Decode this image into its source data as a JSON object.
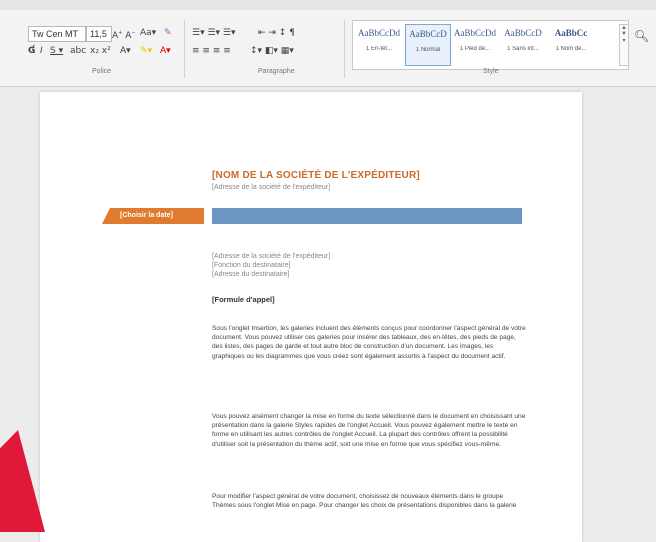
{
  "ribbon": {
    "font_name": "Tw Cen MT (",
    "font_size": "11,5",
    "group_font": "Police",
    "group_paragraph": "Paragraphe",
    "group_style": "Style",
    "styles": [
      {
        "sample": "AaBbCcDd",
        "name": "1 En-têt..."
      },
      {
        "sample": "AaBbCcD",
        "name": "1 Normal"
      },
      {
        "sample": "AaBbCcDd",
        "name": "1 Pied de..."
      },
      {
        "sample": "AaBbCcD",
        "name": "1 Sans int..."
      },
      {
        "sample": "AaBbCc",
        "name": "1 Nom de..."
      }
    ],
    "accent_color": "#2b579a"
  },
  "document": {
    "sender_name": "[NOM DE LA SOCIÉTÉ DE L'EXPÉDITEUR]",
    "sender_address": "[Adresse de la société de l'expéditeur]",
    "date_placeholder": "[Choisir la date]",
    "recipient_lines": [
      "[Adresse de la société de l'expéditeur]",
      "[Fonction du destinataire]",
      "[Adresse du destinataire]"
    ],
    "salutation": "[Formule d'appel]",
    "paragraphs": [
      "Sous l'onglet Insertion, les galeries incluent des éléments conçus pour coordonner l'aspect général de votre document. Vous pouvez utiliser ces galeries pour insérer des tableaux, des en-têtes, des pieds de page, des listes, des pages de garde et tout autre bloc de construction d'un document. Les images, les graphiques ou les diagrammes que vous créez sont également assortis à l'aspect du document actif.",
      "Vous pouvez aisément changer la mise en forme du texte sélectionné dans le document en choisissant une présentation dans la galerie Styles rapides de l'onglet Accueil. Vous pouvez également mettre le texte en forme en utilisant les autres contrôles de l'onglet Accueil. La plupart des contrôles offrent la possibilité d'utiliser soit la présentation du thème actif, soit une mise en forme que vous spécifiez vous-même.",
      "Pour modifier l'aspect général de votre document, choisissez de nouveaux éléments dans le groupe Thèmes sous l'onglet Mise en page. Pour changer les choix de présentations disponibles dans la galerie"
    ],
    "orange": "#e07a2f",
    "blue": "#6d95c4"
  }
}
